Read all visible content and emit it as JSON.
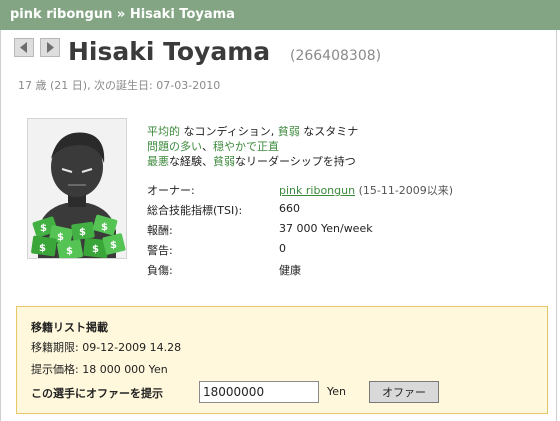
{
  "header": {
    "crumb_team": "pink ribongun",
    "crumb_sep": " » ",
    "crumb_player": "Hisaki Toyama"
  },
  "nav": {
    "prev_icon": "arrow-left-icon",
    "next_icon": "arrow-right-icon"
  },
  "player": {
    "name": "Hisaki Toyama",
    "id": "(266408308)",
    "age_line": "17 歳 (21 日), 次の誕生日: 07-03-2010"
  },
  "traits": {
    "line1": {
      "a": "平均的",
      "b": " なコンディション, ",
      "c": "貧弱",
      "d": " なスタミナ"
    },
    "line2": {
      "a": "問題の多い",
      "b": "、",
      "c": "穏やかで正直"
    },
    "line3": {
      "a": "最悪",
      "b": "な経験、",
      "c": "貧弱",
      "d": "なリーダーシップを持つ"
    }
  },
  "stats": {
    "owner_label": "オーナー:",
    "owner_value": "pink ribongun",
    "owner_since": " (15-11-2009以来)",
    "tsi_label": "総合技能指標(TSI):",
    "tsi_value": "660",
    "wage_label": "報酬:",
    "wage_value": "37 000 Yen/week",
    "warnings_label": "警告:",
    "warnings_value": "0",
    "injury_label": "負傷:",
    "injury_value": "健康"
  },
  "transfer": {
    "heading": "移籍リスト掲載",
    "deadline": "移籍期限: 09-12-2009 14.28",
    "asking": "提示価格: 18 000 000 Yen",
    "offer_label": "この選手にオファーを提示",
    "offer_value": "18000000",
    "unit": "Yen",
    "offer_button": "オファー"
  },
  "colors": {
    "header_bg": "#84a584",
    "green_text": "#3d8a3d",
    "transfer_bg": "#fff8dc",
    "transfer_border": "#e8c96a"
  }
}
